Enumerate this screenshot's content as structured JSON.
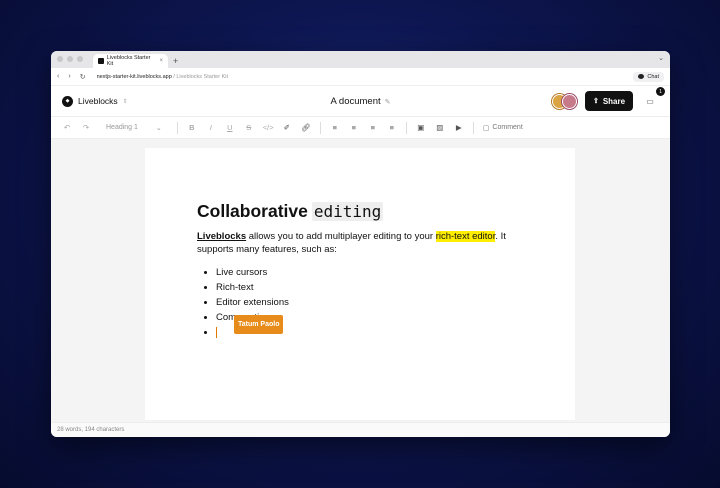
{
  "browser": {
    "tab_title": "Liveblocks Starter Kit",
    "new_tab_label": "+",
    "url_host": "nextjs-starter-kit.liveblocks.app",
    "url_path": "/ Liveblocks Starter Kit",
    "chat_label": "Chat"
  },
  "header": {
    "brand": "Liveblocks",
    "document_title": "A document",
    "share_label": "Share",
    "inbox_badge": "1"
  },
  "toolbar": {
    "heading_select": "Heading 1",
    "comment_label": "Comment"
  },
  "document": {
    "heading_text": "Collaborative",
    "heading_code": "editing",
    "para_link": "Liveblocks",
    "para_text1": " allows you to add multiplayer editing to your ",
    "para_highlight": "rich-text editor",
    "para_text2": ". It supports many features, such as:",
    "list_items": [
      "Live cursors",
      "Rich-text",
      "Editor extensions",
      "Commenting"
    ],
    "collaborator_cursor_name": "Tatum Paolo"
  },
  "status": {
    "word_count": "28 words, 194 characters"
  },
  "colors": {
    "highlight": "#ffee00",
    "cursor": "#e78b1a",
    "share_button": "#111111"
  }
}
